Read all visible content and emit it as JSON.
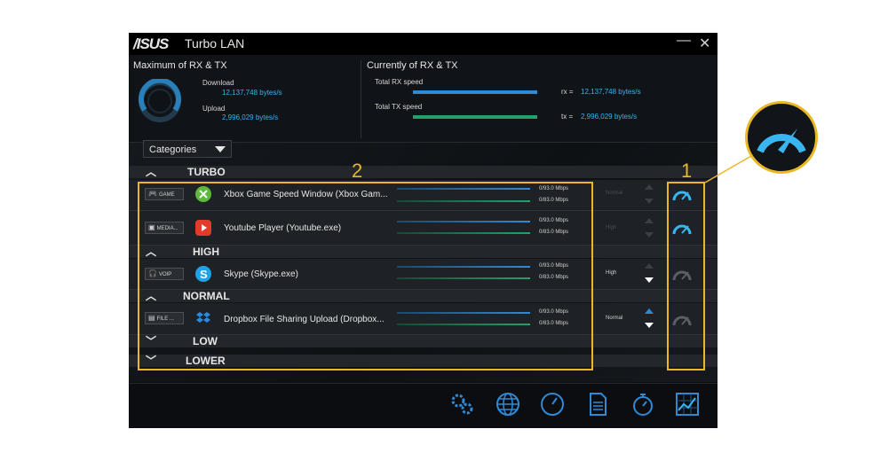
{
  "window": {
    "logo": "/ISUS",
    "title": "Turbo LAN",
    "minimize_icon": "minimize-icon",
    "close_icon": "close-icon"
  },
  "stats": {
    "max_title": "Maximum of RX & TX",
    "download_label": "Download",
    "download_value": "12,137,748 bytes/s",
    "upload_label": "Upload",
    "upload_value": "2,996,029 bytes/s",
    "current_title": "Currently of RX & TX",
    "rx_label": "Total RX speed",
    "tx_label": "Total TX speed",
    "rx_prefix": "rx =",
    "rx_value": "12,137,748 bytes/s",
    "tx_prefix": "tx =",
    "tx_value": "2,996,029 bytes/s"
  },
  "categories_select": {
    "value": "Categories"
  },
  "groups": {
    "turbo": "TURBO",
    "high": "HIGH",
    "normal": "NORMAL",
    "low": "LOW",
    "lower": "LOWER"
  },
  "apps": [
    {
      "category": "GAME",
      "name": "Xbox Game Speed Window (Xbox Gam...",
      "down": "0/93.0 Mbps",
      "up": "0/83.0 Mbps",
      "priority": "Normal",
      "icon": "xbox-icon"
    },
    {
      "category": "MEDIA...",
      "name": "Youtube Player (Youtube.exe)",
      "down": "0/93.0 Mbps",
      "up": "0/83.0 Mbps",
      "priority": "High",
      "icon": "youtube-icon"
    },
    {
      "category": "VOIP",
      "name": "Skype (Skype.exe)",
      "down": "0/93.0 Mbps",
      "up": "0/83.0 Mbps",
      "priority": "High",
      "icon": "skype-icon"
    },
    {
      "category": "FILE ...",
      "name": "Dropbox File Sharing Upload (Dropbox...",
      "down": "0/93.0 Mbps",
      "up": "0/83.0 Mbps",
      "priority": "Normal",
      "icon": "dropbox-icon"
    }
  ],
  "toolbar": [
    "settings-icon",
    "network-globe-icon",
    "speedometer-icon",
    "document-icon",
    "stopwatch-icon",
    "chart-icon"
  ],
  "callouts": {
    "one": "1",
    "two": "2"
  },
  "colors": {
    "accent": "#39b6f0",
    "highlight": "#e9b825",
    "rx_bar": "#2f8ad6",
    "tx_bar": "#27a06a"
  }
}
